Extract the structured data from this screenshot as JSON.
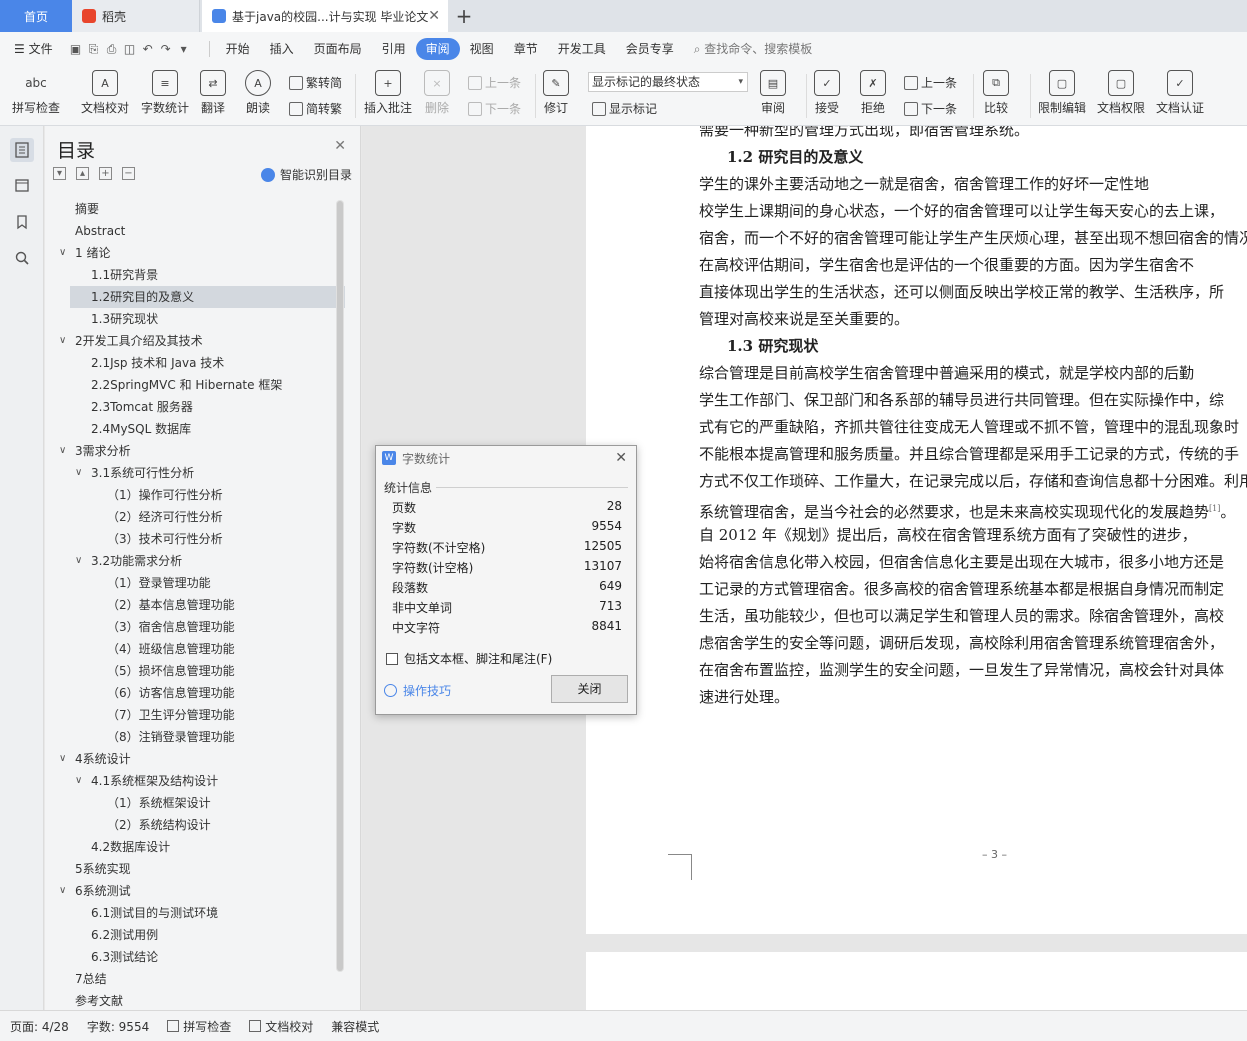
{
  "tabs": {
    "home": "首页",
    "daoke": "稻壳",
    "doc": "基于java的校园...计与实现 毕业论文",
    "close": "✕",
    "add": "+"
  },
  "menu": {
    "file": "文件",
    "items": [
      "开始",
      "插入",
      "页面布局",
      "引用",
      "审阅",
      "视图",
      "章节",
      "开发工具",
      "会员专享"
    ],
    "search": "查找命令、搜索模板"
  },
  "ribbon": {
    "spell": "拼写检查",
    "proofread": "文档校对",
    "wordcount": "字数统计",
    "translate": "翻译",
    "read": "朗读",
    "trad": "繁转简",
    "simp": "简转繁",
    "insert_comment": "插入批注",
    "delete": "删除",
    "prev": "上一条",
    "next": "下一条",
    "track": "修订",
    "show_state": "显示标记的最终状态",
    "show_marks": "显示标记",
    "review": "审阅",
    "accept": "接受",
    "reject": "拒绝",
    "prev2": "上一条",
    "next2": "下一条",
    "compare": "比较",
    "restrict": "限制编辑",
    "permission": "文档权限",
    "certify": "文档认证"
  },
  "toc": {
    "title": "目录",
    "smart": "智能识别目录",
    "items": [
      {
        "label": "摘要",
        "indent": 0,
        "arrow": ""
      },
      {
        "label": "Abstract",
        "indent": 0,
        "arrow": ""
      },
      {
        "label": "1 绪论",
        "indent": 0,
        "arrow": "v"
      },
      {
        "label": "1.1研究背景",
        "indent": 1,
        "arrow": ""
      },
      {
        "label": "1.2研究目的及意义",
        "indent": 1,
        "arrow": "",
        "selected": true
      },
      {
        "label": "1.3研究现状",
        "indent": 1,
        "arrow": ""
      },
      {
        "label": "2开发工具介绍及其技术",
        "indent": 0,
        "arrow": "v"
      },
      {
        "label": "2.1Jsp 技术和 Java 技术",
        "indent": 1,
        "arrow": ""
      },
      {
        "label": "2.2SpringMVC 和 Hibernate 框架",
        "indent": 1,
        "arrow": ""
      },
      {
        "label": "2.3Tomcat 服务器",
        "indent": 1,
        "arrow": ""
      },
      {
        "label": "2.4MySQL 数据库",
        "indent": 1,
        "arrow": ""
      },
      {
        "label": "3需求分析",
        "indent": 0,
        "arrow": "v"
      },
      {
        "label": "3.1系统可行性分析",
        "indent": 1,
        "arrow": "v"
      },
      {
        "label": "（1）操作可行性分析",
        "indent": 2,
        "arrow": ""
      },
      {
        "label": "（2）经济可行性分析",
        "indent": 2,
        "arrow": ""
      },
      {
        "label": "（3）技术可行性分析",
        "indent": 2,
        "arrow": ""
      },
      {
        "label": "3.2功能需求分析",
        "indent": 1,
        "arrow": "v"
      },
      {
        "label": "（1）登录管理功能",
        "indent": 2,
        "arrow": ""
      },
      {
        "label": "（2）基本信息管理功能",
        "indent": 2,
        "arrow": ""
      },
      {
        "label": "（3）宿舍信息管理功能",
        "indent": 2,
        "arrow": ""
      },
      {
        "label": "（4）班级信息管理功能",
        "indent": 2,
        "arrow": ""
      },
      {
        "label": "（5）损坏信息管理功能",
        "indent": 2,
        "arrow": ""
      },
      {
        "label": "（6）访客信息管理功能",
        "indent": 2,
        "arrow": ""
      },
      {
        "label": "（7）卫生评分管理功能",
        "indent": 2,
        "arrow": ""
      },
      {
        "label": "（8）注销登录管理功能",
        "indent": 2,
        "arrow": ""
      },
      {
        "label": "4系统设计",
        "indent": 0,
        "arrow": "v"
      },
      {
        "label": "4.1系统框架及结构设计",
        "indent": 1,
        "arrow": "v"
      },
      {
        "label": "（1）系统框架设计",
        "indent": 2,
        "arrow": ""
      },
      {
        "label": "（2）系统结构设计",
        "indent": 2,
        "arrow": ""
      },
      {
        "label": "4.2数据库设计",
        "indent": 1,
        "arrow": ""
      },
      {
        "label": "5系统实现",
        "indent": 0,
        "arrow": ""
      },
      {
        "label": "6系统测试",
        "indent": 0,
        "arrow": "v"
      },
      {
        "label": "6.1测试目的与测试环境",
        "indent": 1,
        "arrow": ""
      },
      {
        "label": "6.2测试用例",
        "indent": 1,
        "arrow": ""
      },
      {
        "label": "6.3测试结论",
        "indent": 1,
        "arrow": ""
      },
      {
        "label": "7总结",
        "indent": 0,
        "arrow": ""
      },
      {
        "label": "参考文献",
        "indent": 0,
        "arrow": ""
      }
    ]
  },
  "document": {
    "lines": [
      {
        "text": "需要一种新型的管理方式出现，即宿舍管理系统。",
        "cls": ""
      },
      {
        "text": "1.2  研究目的及意义",
        "cls": "ph"
      },
      {
        "text": "    学生的课外主要活动地之一就是宿舍，宿舍管理工作的好坏一定性地",
        "cls": ""
      },
      {
        "text": "校学生上课期间的身心状态，一个好的宿舍管理可以让学生每天安心的去上课，",
        "cls": ""
      },
      {
        "text": "宿舍，而一个不好的宿舍管理可能让学生产生厌烦心理，甚至出现不想回宿舍的情况",
        "cls": ""
      },
      {
        "text": "    在高校评估期间，学生宿舍也是评估的一个很重要的方面。因为学生宿舍不",
        "cls": ""
      },
      {
        "text": "直接体现出学生的生活状态，还可以侧面反映出学校正常的教学、生活秩序，所",
        "cls": ""
      },
      {
        "text": "管理对高校来说是至关重要的。",
        "cls": ""
      },
      {
        "text": "1.3  研究现状",
        "cls": "ph"
      },
      {
        "text": "    综合管理是目前高校学生宿舍管理中普遍采用的模式，就是学校内部的后勤",
        "cls": ""
      },
      {
        "text": "学生工作部门、保卫部门和各系部的辅导员进行共同管理。但在实际操作中，综",
        "cls": ""
      },
      {
        "text": "式有它的严重缺陷，齐抓共管往往变成无人管理或不抓不管，管理中的混乱现象时",
        "cls": ""
      },
      {
        "text": "不能根本提高管理和服务质量。并且综合管理都是采用手工记录的方式，传统的手",
        "cls": ""
      },
      {
        "text": "方式不仅工作琐碎、工作量大，在记录完成以后，存储和查询信息都十分困难。利用",
        "cls": ""
      },
      {
        "text": "系统管理宿舍，是当今社会的必然要求，也是未来高校实现现代化的发展趋势",
        "cls": "",
        "sup": "[1]",
        "tail": "。"
      },
      {
        "text": "    自  2012 年《规划》提出后，高校在宿舍管理系统方面有了突破性的进步，",
        "cls": ""
      },
      {
        "text": "始将宿舍信息化带入校园，但宿舍信息化主要是出现在大城市，很多小地方还是",
        "cls": ""
      },
      {
        "text": "工记录的方式管理宿舍。很多高校的宿舍管理系统基本都是根据自身情况而制定",
        "cls": ""
      },
      {
        "text": "生活，虽功能较少，但也可以满足学生和管理人员的需求。除宿舍管理外，高校",
        "cls": ""
      },
      {
        "text": "虑宿舍学生的安全等问题，调研后发现，高校除利用宿舍管理系统管理宿舍外，",
        "cls": ""
      },
      {
        "text": "在宿舍布置监控，监测学生的安全问题，一旦发生了异常情况，高校会针对具体",
        "cls": ""
      },
      {
        "text": "速进行处理。",
        "cls": ""
      }
    ],
    "page_number": "– 3 –"
  },
  "dialog": {
    "title": "字数统计",
    "section": "统计信息",
    "rows": [
      {
        "label": "页数",
        "value": "28"
      },
      {
        "label": "字数",
        "value": "9554"
      },
      {
        "label": "字符数(不计空格)",
        "value": "12505"
      },
      {
        "label": "字符数(计空格)",
        "value": "13107"
      },
      {
        "label": "段落数",
        "value": "649"
      },
      {
        "label": "非中文单词",
        "value": "713"
      },
      {
        "label": "中文字符",
        "value": "8841"
      }
    ],
    "checkbox": "包括文本框、脚注和尾注(F)",
    "tips": "操作技巧",
    "close_btn": "关闭"
  },
  "status": {
    "page": "页面: 4/28",
    "words": "字数: 9554",
    "spell": "拼写检查",
    "proof": "文档校对",
    "compat": "兼容模式"
  },
  "colors": {
    "accent": "#4a86e8",
    "daoke_icon": "#e8452c"
  }
}
